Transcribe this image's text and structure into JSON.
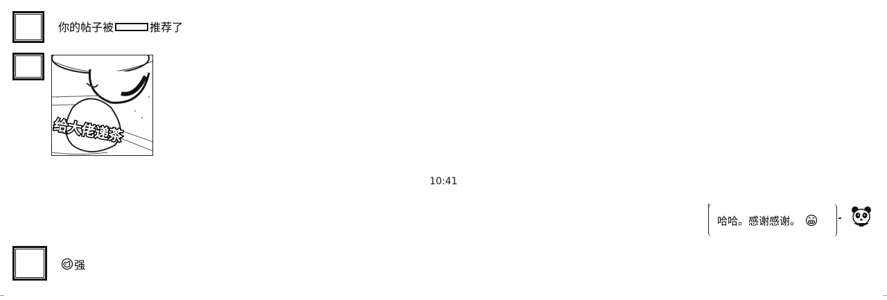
{
  "messages": [
    {
      "sender": "other",
      "text_before": "你的帖子被",
      "text_after": "推荐了"
    },
    {
      "sender": "other",
      "sticker_caption": "给大佬递茶"
    },
    {
      "sender": "other",
      "emoji": "strong-emoji",
      "text": "强"
    }
  ],
  "timestamp": "10:41",
  "my_message": {
    "text": "哈哈。感谢感谢。",
    "emoji": "grin-emoji",
    "avatar": "panda"
  }
}
